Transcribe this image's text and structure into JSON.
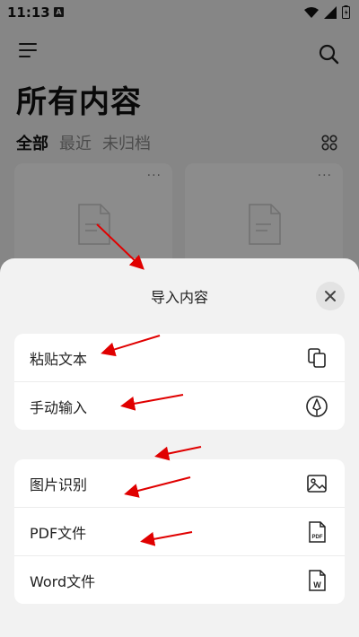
{
  "status": {
    "time": "11:13",
    "notif": "A"
  },
  "page": {
    "title": "所有内容"
  },
  "tabs": [
    {
      "label": "全部",
      "active": true
    },
    {
      "label": "最近",
      "active": false
    },
    {
      "label": "未归档",
      "active": false
    }
  ],
  "cards": [
    {
      "more": "···"
    },
    {
      "more": "···"
    }
  ],
  "sheet": {
    "title": "导入内容",
    "group1": [
      {
        "label": "粘贴文本",
        "icon": "copy-icon"
      },
      {
        "label": "手动输入",
        "icon": "pen-icon"
      }
    ],
    "group2": [
      {
        "label": "图片识别",
        "icon": "image-icon"
      },
      {
        "label": "PDF文件",
        "icon": "pdf-file-icon",
        "badge": "PDF"
      },
      {
        "label": "Word文件",
        "icon": "word-file-icon",
        "badge": "W"
      }
    ]
  },
  "annotation_color": "#e00000"
}
